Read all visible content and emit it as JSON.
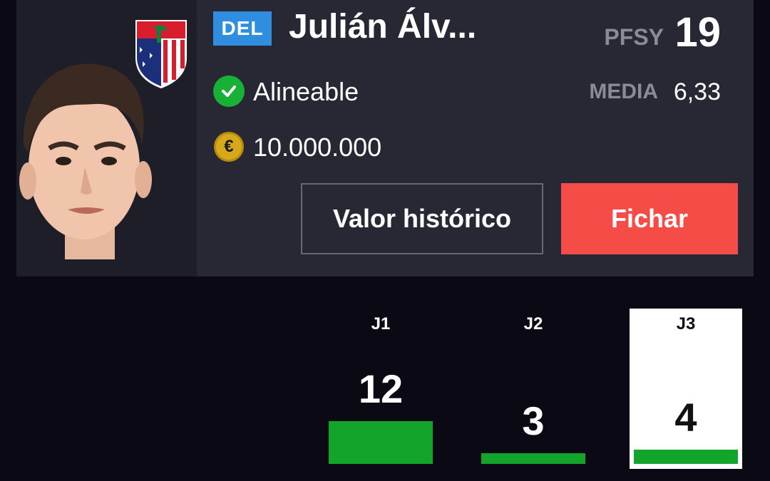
{
  "player": {
    "position": "DEL",
    "name": "Julián Álv...",
    "status": "Alineable",
    "price": "10.000.000",
    "pfsy_label": "PFSY",
    "pfsy_value": "19",
    "media_label": "MEDIA",
    "media_value": "6,33"
  },
  "actions": {
    "history_label": "Valor histórico",
    "sign_label": "Fichar"
  },
  "icons": {
    "status": "check-circle-icon",
    "currency": "euro-coin-icon",
    "team": "atletico-madrid-crest"
  },
  "colors": {
    "position_badge": "#2f8ee0",
    "status_ok": "#19b135",
    "sign_button": "#f64c47",
    "points_bar": "#13a42b"
  },
  "rounds": [
    {
      "label": "J1",
      "points": "12",
      "level": 12,
      "selected": false
    },
    {
      "label": "J2",
      "points": "3",
      "level": 3,
      "selected": false
    },
    {
      "label": "J3",
      "points": "4",
      "level": 4,
      "selected": true
    }
  ]
}
